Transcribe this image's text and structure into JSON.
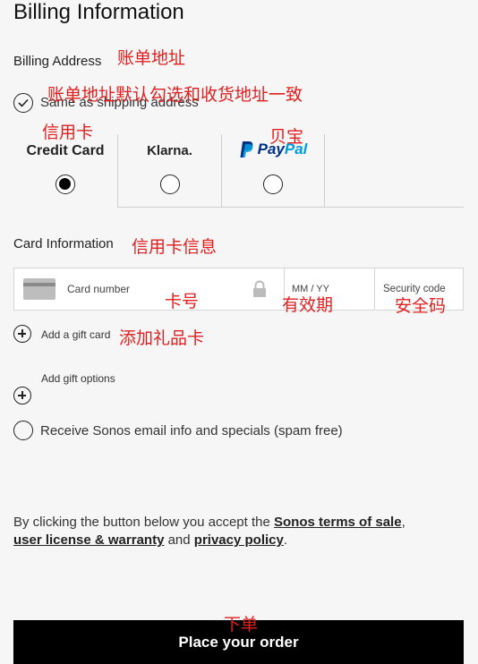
{
  "header": {
    "title": "Billing Information"
  },
  "billing_address": {
    "label": "Billing Address",
    "same_as_shipping": "Same as shipping address"
  },
  "payment_methods": [
    {
      "label": "Credit Card",
      "selected": true
    },
    {
      "label": "Klarna.",
      "selected": false
    },
    {
      "label_pay1": "Pay",
      "label_pay2": "Pal",
      "selected": false
    }
  ],
  "card_info": {
    "label": "Card Information",
    "card_number_placeholder": "Card number",
    "expiry_placeholder": "MM / YY",
    "security_placeholder": "Security code"
  },
  "gift": {
    "add_gift_card": "Add a gift card",
    "add_gift_options": "Add gift options"
  },
  "email_opt_in": "Receive Sonos email info and specials (spam free)",
  "terms": {
    "prefix": "By clicking the button below you accept the ",
    "terms_link": "Sonos terms of sale",
    "comma": ",",
    "license_link": "user license & warranty",
    "and": " and ",
    "privacy_link": "privacy policy",
    "period": "."
  },
  "order_button": "Place your order",
  "annotations": {
    "billing_address": "账单地址",
    "same_as_shipping": "账单地址默认勾选和收货地址一致",
    "credit_card": "信用卡",
    "paypal": "贝宝",
    "card_info": "信用卡信息",
    "card_number": "卡号",
    "expiry": "有效期",
    "security": "安全码",
    "gift_card": "添加礼品卡",
    "order": "下单"
  },
  "colors": {
    "annotation": "#e02020",
    "paypal_dark": "#003087",
    "paypal_light": "#009cde",
    "button_bg": "#000000"
  }
}
